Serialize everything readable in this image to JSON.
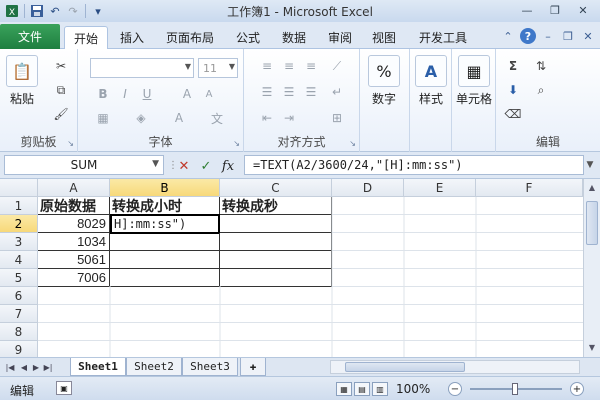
{
  "window": {
    "title": "工作簿1 - Microsoft Excel"
  },
  "ribbon_tabs": [
    "文件",
    "开始",
    "插入",
    "页面布局",
    "公式",
    "数据",
    "审阅",
    "视图",
    "开发工具"
  ],
  "ribbon": {
    "clipboard": {
      "label": "剪贴板",
      "paste_label": "粘贴"
    },
    "font": {
      "label": "字体",
      "font_size": "11"
    },
    "alignment": {
      "label": "对齐方式"
    },
    "number": {
      "label": "数字",
      "percent_symbol": "%"
    },
    "style": {
      "label": "样式"
    },
    "cells": {
      "label": "单元格"
    },
    "editing": {
      "label": "编辑"
    }
  },
  "formula_bar": {
    "name_box": "SUM",
    "fx_label": "fx",
    "formula": "=TEXT(A2/3600/24,\"[H]:mm:ss\")"
  },
  "grid": {
    "columns": [
      "A",
      "B",
      "C",
      "D",
      "E",
      "F"
    ],
    "selected_column": "B",
    "rows": [
      "1",
      "2",
      "3",
      "4",
      "5",
      "6",
      "7",
      "8",
      "9",
      "10"
    ],
    "selected_row": "2",
    "cells": {
      "A1": "原始数据",
      "B1": "转换成小时",
      "C1": "转换成秒",
      "A2": "8029",
      "B2": "H]:mm:ss\")",
      "A3": "1034",
      "A4": "5061",
      "A5": "7006"
    }
  },
  "sheets": [
    "Sheet1",
    "Sheet2",
    "Sheet3"
  ],
  "active_sheet": "Sheet1",
  "status": {
    "mode": "编辑",
    "zoom": "100%",
    "zoom_out": "−",
    "zoom_in": "+"
  },
  "icons": {
    "save": "save-icon",
    "undo": "undo-icon",
    "redo": "redo-icon",
    "help": "help-icon"
  }
}
